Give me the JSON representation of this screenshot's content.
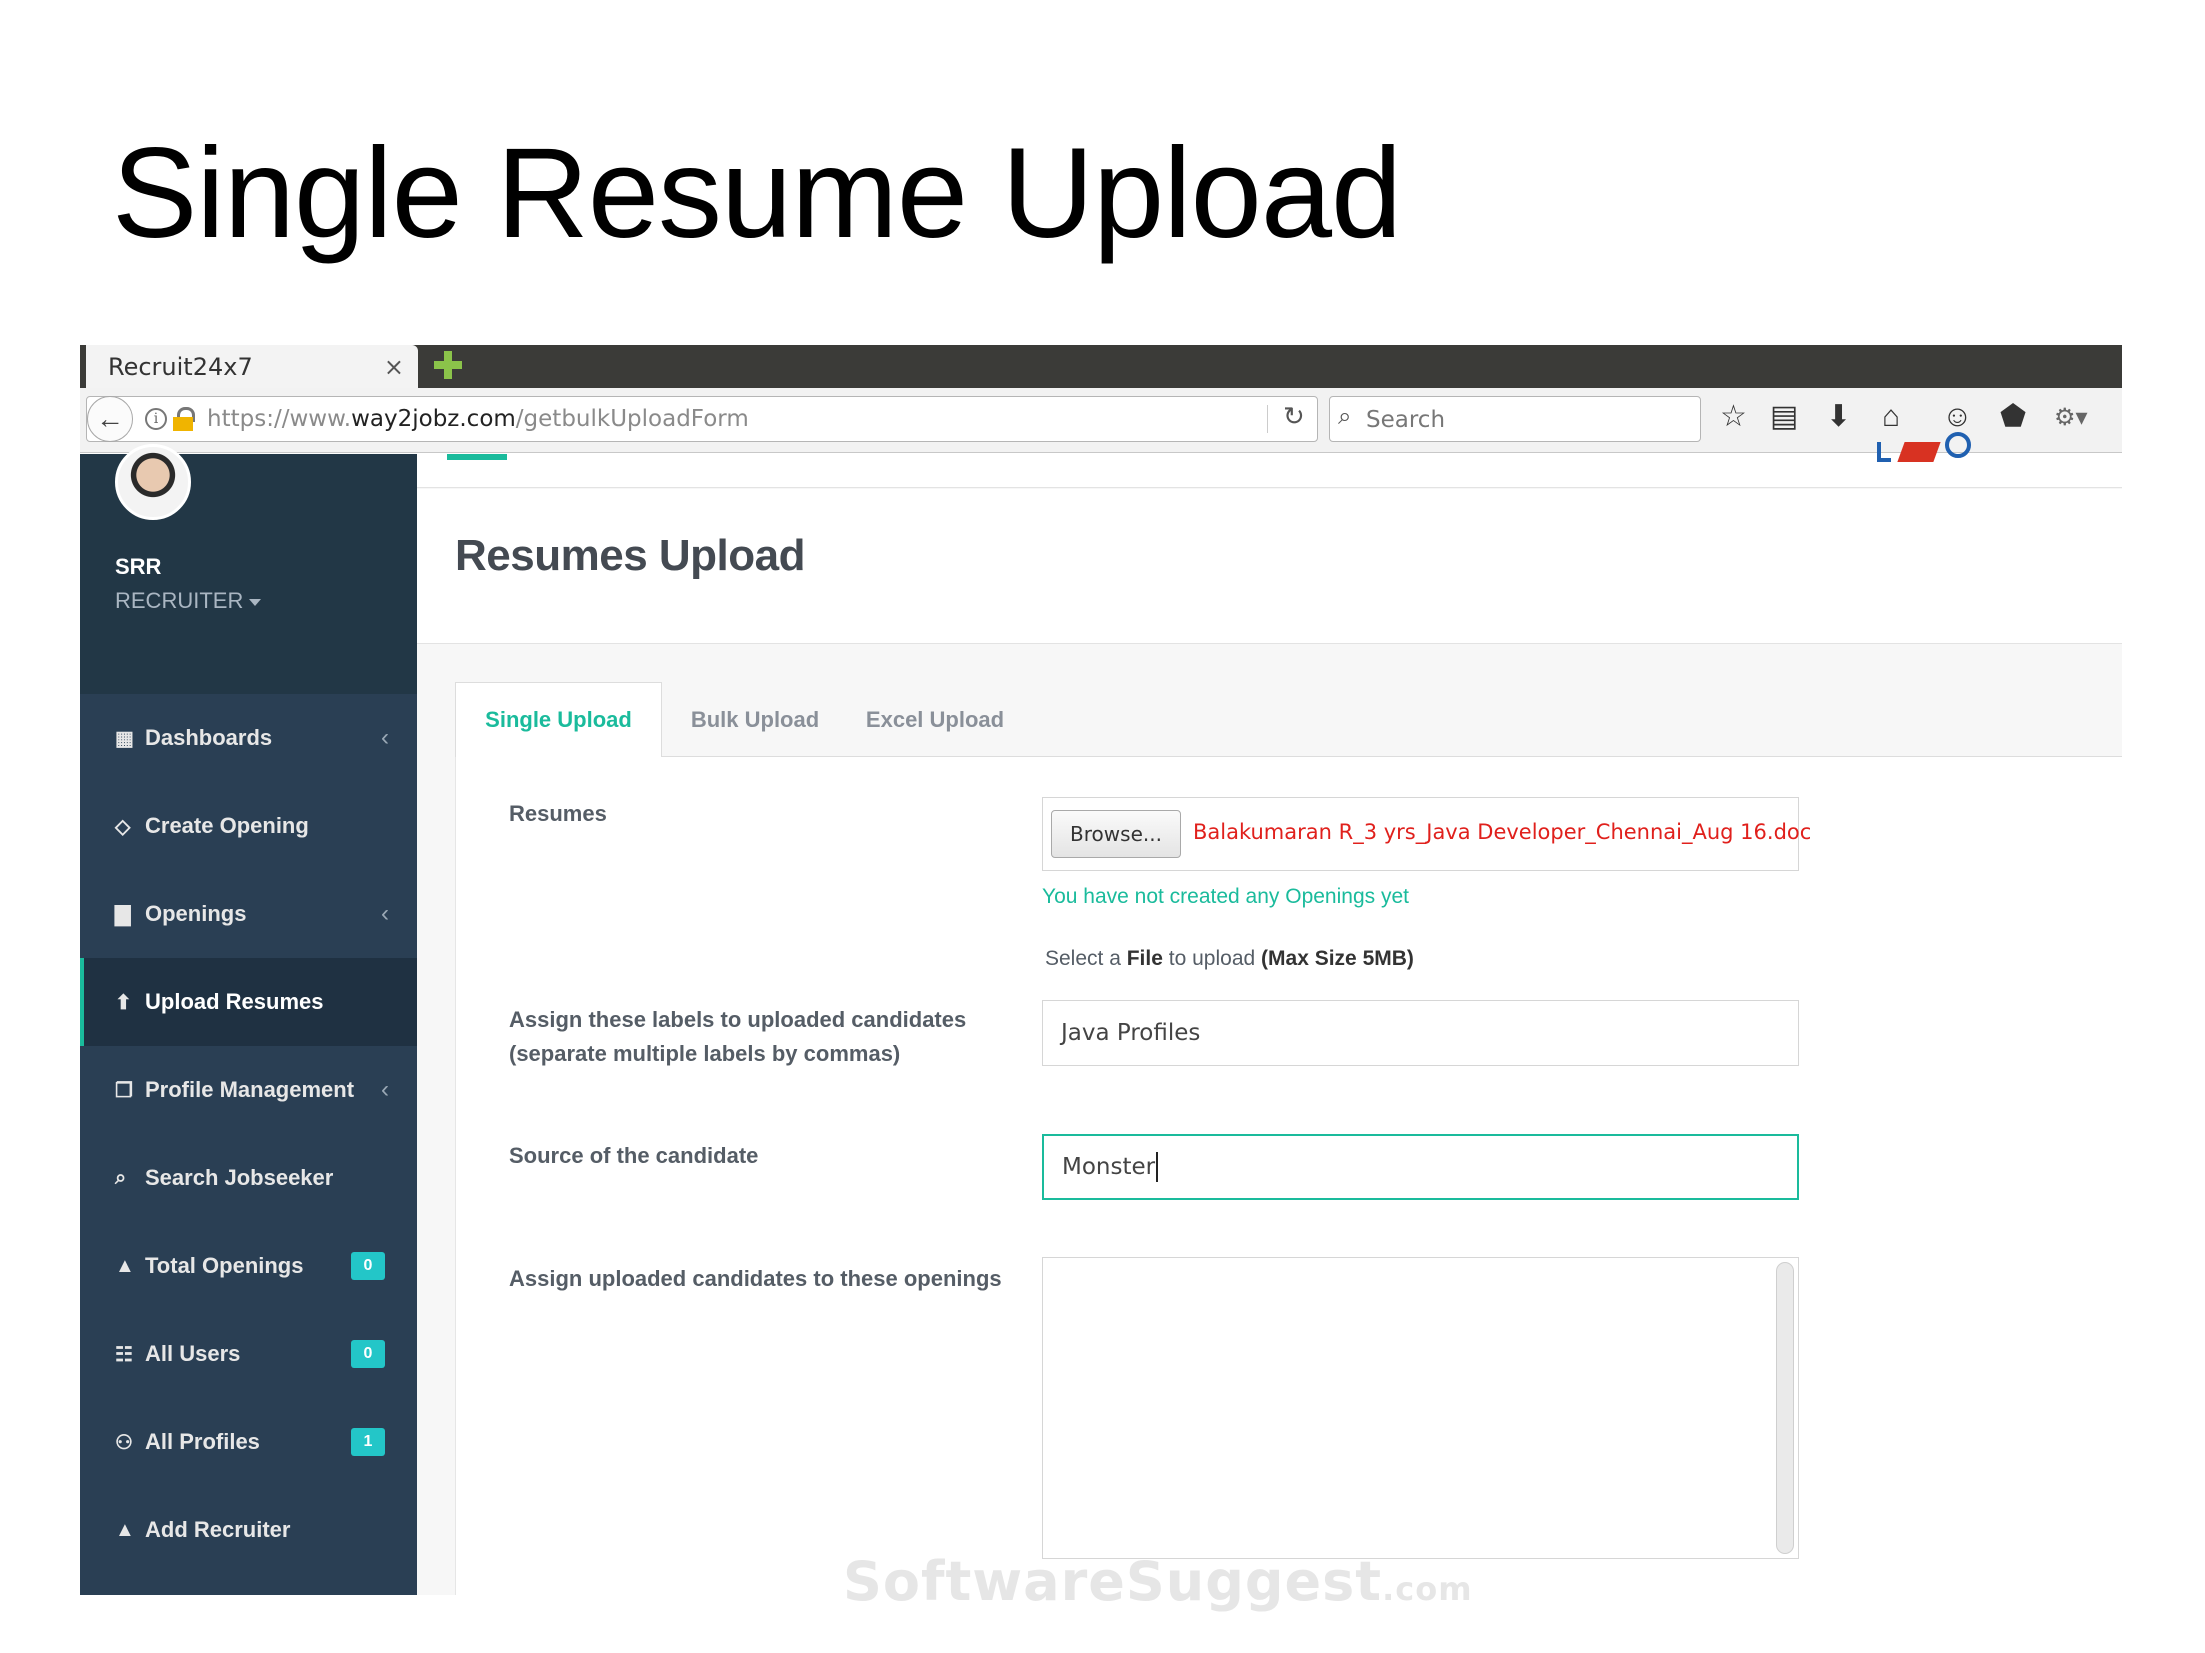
{
  "slide": {
    "title": "Single Resume Upload"
  },
  "browser": {
    "tab_title": "Recruit24x7",
    "tab_close": "×",
    "url_prefix": "https://www.",
    "url_host": "way2jobz.com",
    "url_path": "/getbulkUploadForm",
    "search_placeholder": "Search"
  },
  "sidebar": {
    "user_name": "SRR",
    "user_role": "RECRUITER",
    "items": [
      {
        "label": "Dashboards",
        "icon": "dashboard-icon",
        "chevron": "‹"
      },
      {
        "label": "Create Opening",
        "icon": "diamond-icon"
      },
      {
        "label": "Openings",
        "icon": "bar-chart-icon",
        "chevron": "‹"
      },
      {
        "label": "Upload Resumes",
        "icon": "upload-icon"
      },
      {
        "label": "Profile Management",
        "icon": "clipboard-icon",
        "chevron": "‹"
      },
      {
        "label": "Search Jobseeker",
        "icon": "search-icon"
      },
      {
        "label": "Total Openings",
        "icon": "user-icon",
        "badge": "0"
      },
      {
        "label": "All Users",
        "icon": "sitemap-icon",
        "badge": "0"
      },
      {
        "label": "All Profiles",
        "icon": "users-icon",
        "badge": "1"
      },
      {
        "label": "Add Recruiter",
        "icon": "user-icon"
      }
    ],
    "active_item": "Upload Resumes"
  },
  "main": {
    "page_title": "Resumes Upload",
    "tabs": [
      {
        "label": "Single Upload"
      },
      {
        "label": "Bulk Upload"
      },
      {
        "label": "Excel Upload"
      }
    ],
    "active_tab": "Single Upload",
    "form": {
      "resumes_label": "Resumes",
      "browse_label": "Browse...",
      "selected_file": "Balakumaran R_3 yrs_Java Developer_Chennai_Aug 16.doc",
      "no_openings_msg": "You have not created any Openings yet",
      "size_hint_prefix": "Select a",
      "size_hint_file": "File",
      "size_hint_mid": "to upload",
      "size_hint_max": "(Max Size 5MB)",
      "labels_label_1": "Assign these labels to uploaded candidates",
      "labels_label_2": "(separate multiple labels by commas)",
      "labels_value": "Java Profiles",
      "source_label": "Source of the candidate",
      "source_value": "Monster",
      "openings_label": "Assign uploaded candidates to these openings"
    }
  },
  "watermark": {
    "main": "SoftwareSuggest",
    "suffix": ".com"
  },
  "colors": {
    "accent": "#1abb9c",
    "sidebar": "#2a3f54",
    "badge": "#23c6c8",
    "file_red": "#e0201c"
  }
}
